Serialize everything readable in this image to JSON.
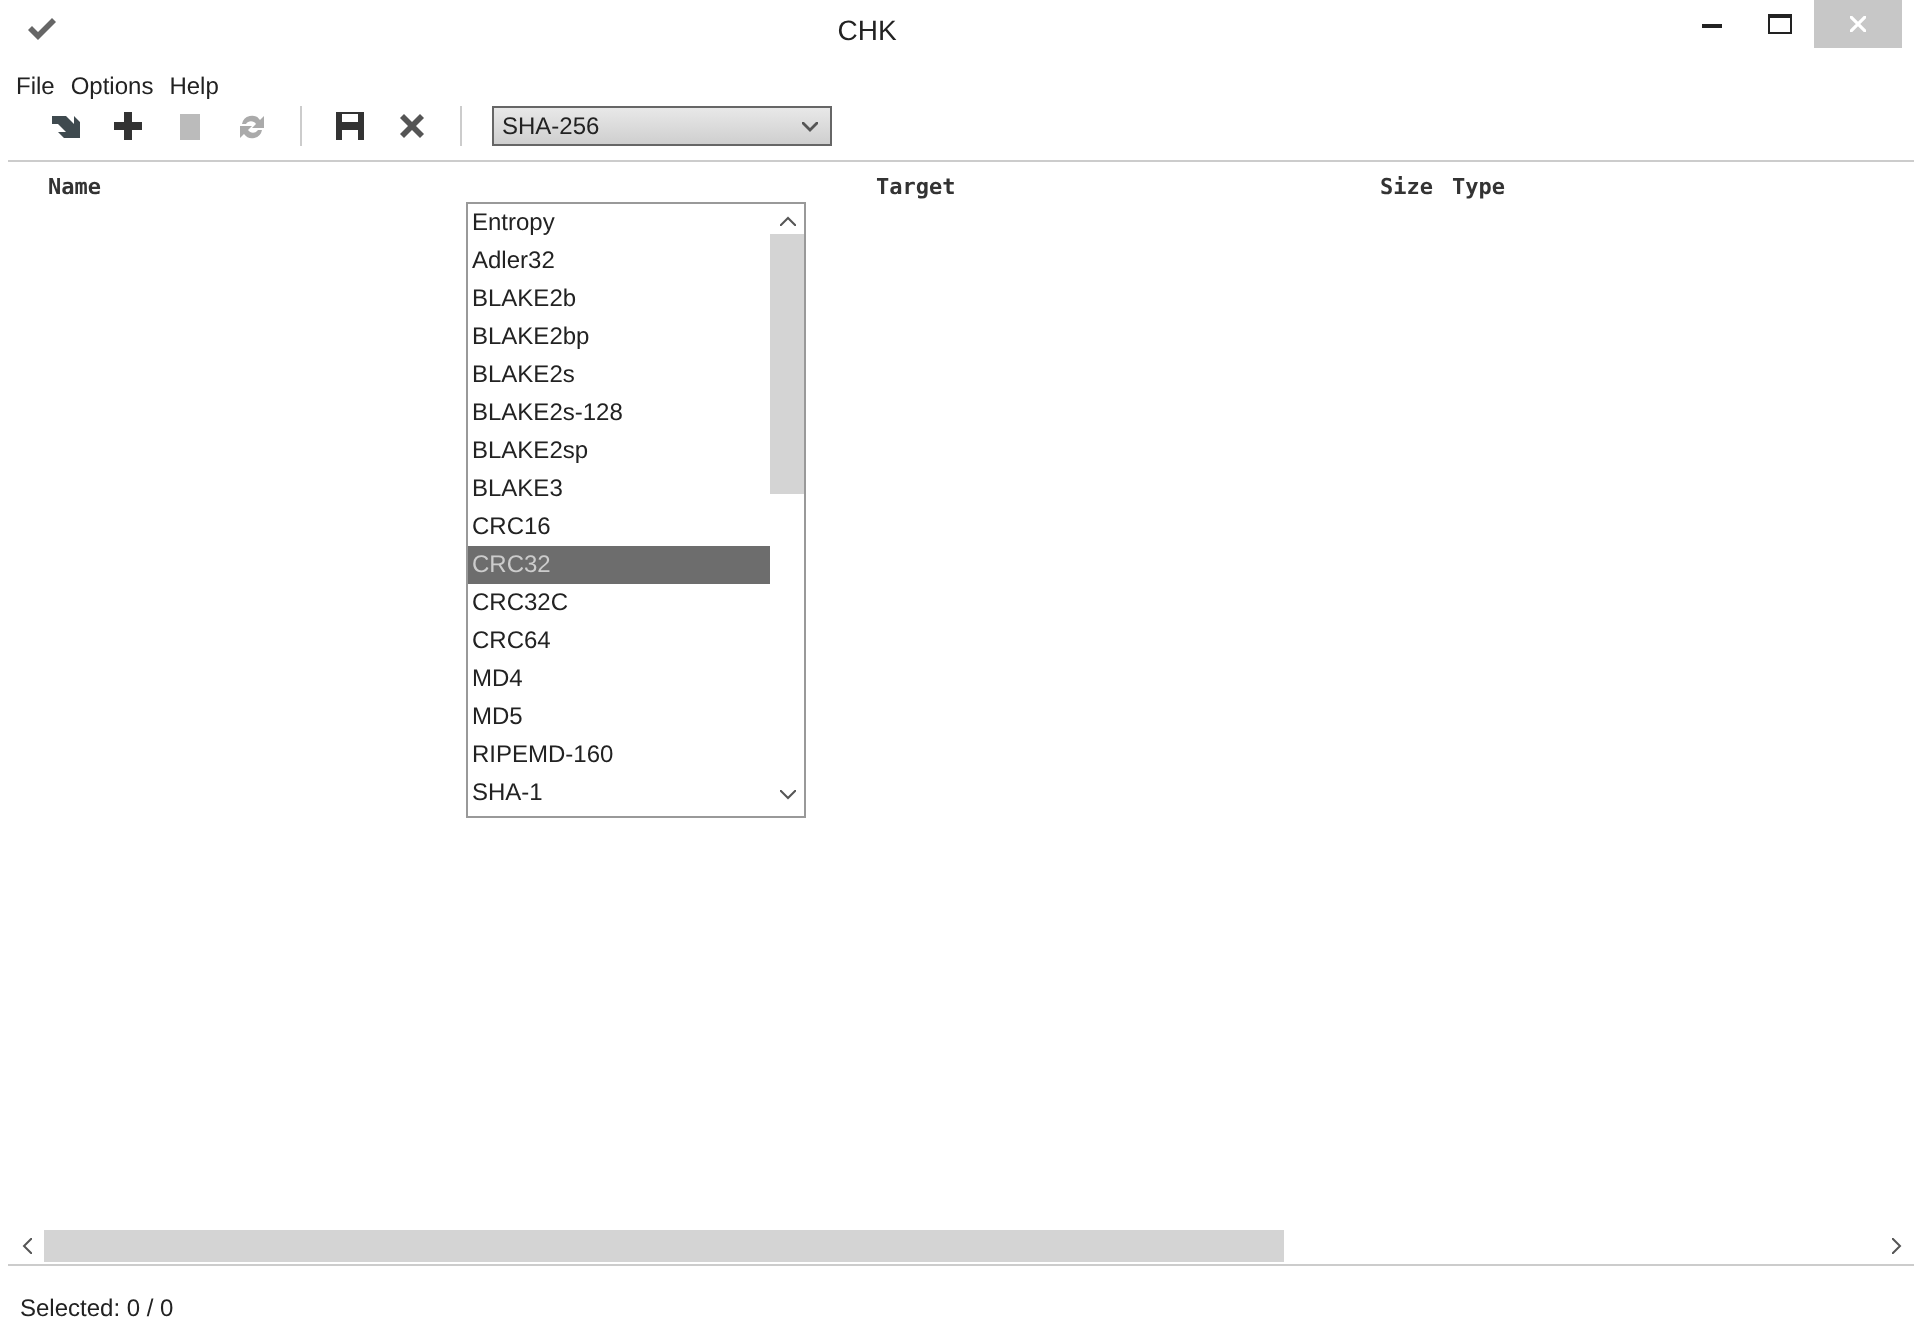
{
  "window": {
    "title": "CHK"
  },
  "menu": [
    {
      "label": "File"
    },
    {
      "label": "Options"
    },
    {
      "label": "Help"
    }
  ],
  "algorithm_combo": {
    "value": "SHA-256",
    "expanded": true
  },
  "algorithm_options": [
    {
      "label": "Entropy",
      "selected": false
    },
    {
      "label": "Adler32",
      "selected": false
    },
    {
      "label": "BLAKE2b",
      "selected": false
    },
    {
      "label": "BLAKE2bp",
      "selected": false
    },
    {
      "label": "BLAKE2s",
      "selected": false
    },
    {
      "label": "BLAKE2s-128",
      "selected": false
    },
    {
      "label": "BLAKE2sp",
      "selected": false
    },
    {
      "label": "BLAKE3",
      "selected": false
    },
    {
      "label": "CRC16",
      "selected": false
    },
    {
      "label": "CRC32",
      "selected": true
    },
    {
      "label": "CRC32C",
      "selected": false
    },
    {
      "label": "CRC64",
      "selected": false
    },
    {
      "label": "MD4",
      "selected": false
    },
    {
      "label": "MD5",
      "selected": false
    },
    {
      "label": "RIPEMD-160",
      "selected": false
    },
    {
      "label": "SHA-1",
      "selected": false
    }
  ],
  "table": {
    "columns": [
      "Name",
      "Target",
      "Size",
      "Type"
    ]
  },
  "status_bar": {
    "text": "Selected: 0 / 0"
  }
}
